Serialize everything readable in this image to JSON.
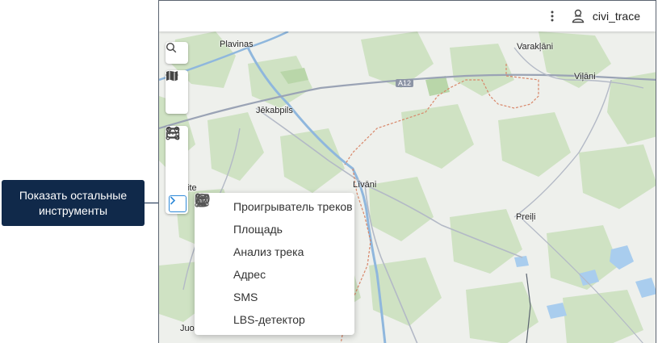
{
  "header": {
    "menu_icon": "kebab-menu-icon",
    "user_icon": "user-icon",
    "username": "civi_trace"
  },
  "map": {
    "labels": {
      "plavinas": "Plavinas",
      "varaklani": "Varakļāni",
      "vilani": "Viļāni",
      "jekabpils": "Jēkabpils",
      "livani": "Līvāni",
      "preili": "Preiļi",
      "ite": "ite",
      "juod": "Juod"
    },
    "road_shield": "A12"
  },
  "toolbar": {
    "search_icon": "search-icon",
    "eye_icon": "eye-icon",
    "map_icon": "map-icon",
    "ruler_icon": "ruler-icon",
    "route_icon": "route-icon",
    "points_icon": "points-route-icon",
    "expand_icon": "chevron-right-icon"
  },
  "tools_menu": {
    "items": [
      {
        "label": "Проигрыватель треков",
        "icon": "track-player-icon"
      },
      {
        "label": "Площадь",
        "icon": "area-icon"
      },
      {
        "label": "Анализ трека",
        "icon": "track-analysis-icon"
      },
      {
        "label": "Адрес",
        "icon": "address-pin-icon"
      },
      {
        "label": "SMS",
        "icon": "sms-icon"
      },
      {
        "label": "LBS-детектор",
        "icon": "lbs-detector-icon"
      }
    ]
  },
  "callout": {
    "text": "Показать остальные инструменты"
  },
  "colors": {
    "callout_bg": "#10294a",
    "accent": "#2f8ad8",
    "forest": "#cfe2c3",
    "water": "#a9cdee"
  }
}
